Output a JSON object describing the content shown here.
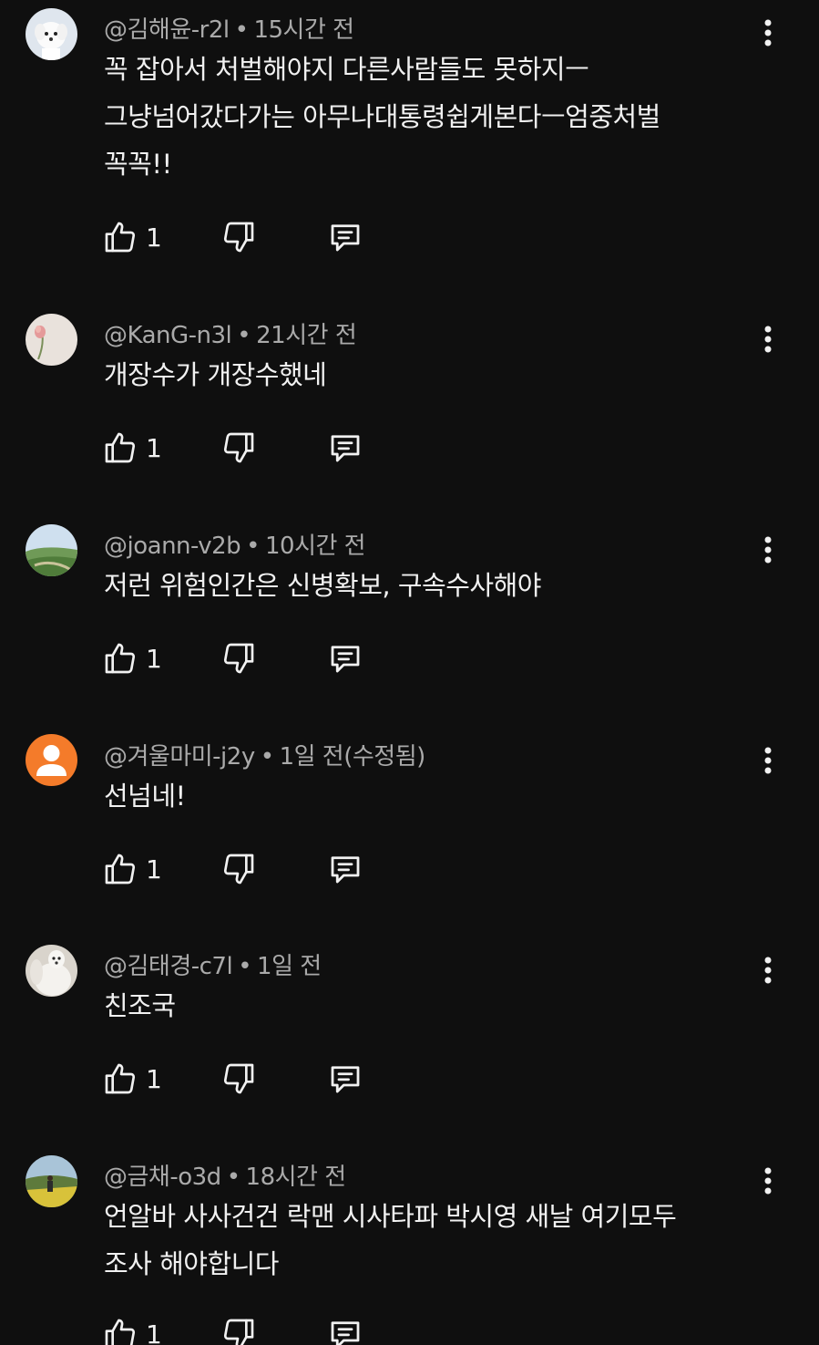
{
  "comments": [
    {
      "handle": "@김해윤-r2l",
      "time": "15시간 전",
      "lines": [
        "꼭 잡아서 처벌해야지 다른사람들도 못하지ㅡ",
        "그냥넘어갔다가는  아무나대통령쉽게본다ㅡ엄중처벌",
        "꼭꼭!!"
      ],
      "likes": "1",
      "avatar": "white-dog"
    },
    {
      "handle": "@KanG-n3l",
      "time": "21시간 전",
      "lines": [
        "개장수가 개장수했네"
      ],
      "likes": "1",
      "avatar": "flower"
    },
    {
      "handle": "@joann-v2b",
      "time": "10시간 전",
      "lines": [
        "저런 위험인간은 신병확보, 구속수사해야"
      ],
      "likes": "1",
      "avatar": "landscape"
    },
    {
      "handle": "@겨울마미-j2y",
      "time": "1일 전(수정됨)",
      "lines": [
        "선넘네!"
      ],
      "likes": "1",
      "avatar": "default-person"
    },
    {
      "handle": "@김태경-c7l",
      "time": "1일 전",
      "lines": [
        "친조국"
      ],
      "likes": "1",
      "avatar": "white-dog-2"
    },
    {
      "handle": "@금채-o3d",
      "time": "18시간 전",
      "lines": [
        "언알바 사사건건 락맨 시사타파 박시영 새날 여기모두",
        "조사 해야합니다"
      ],
      "likes": "1",
      "avatar": "field"
    }
  ],
  "separator": "•",
  "icons": {
    "like": "thumbs-up-icon",
    "dislike": "thumbs-down-icon",
    "reply": "reply-comment-icon",
    "more": "more-vertical-icon"
  },
  "colors": {
    "background": "#0f0f0f",
    "text": "#f1f1f1",
    "meta": "#aaaaaa",
    "default_avatar": "#f47b2a"
  }
}
